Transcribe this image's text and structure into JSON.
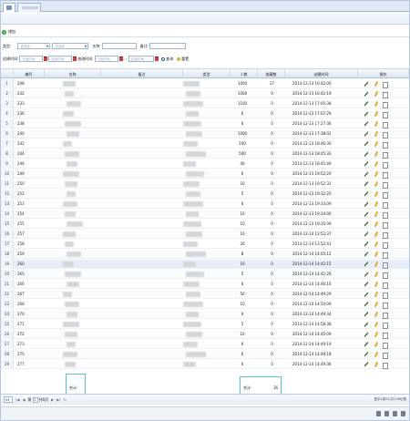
{
  "toolbar": {
    "add_label": "增加"
  },
  "filters": {
    "type_label": "类型:",
    "type_placeholder": "请选择",
    "name_label": "名称:",
    "remark_label": "备注:",
    "created_label": "创建时间:",
    "created_start_placeholder": "开始时间",
    "created_end_placeholder": "结束时间",
    "updated_label": "修改时间:",
    "updated_start_placeholder": "开始时间",
    "updated_end_placeholder": "结束时间",
    "search_label": "查询",
    "reset_label": "重置"
  },
  "grid": {
    "columns": [
      "编号",
      "名称",
      "备注",
      "类型",
      "人数",
      "收藏数",
      "创建时间",
      "操作"
    ],
    "rows": [
      {
        "index": "1",
        "code": "208",
        "people": "1000",
        "collects": "27",
        "time": "2014-12-13 16:42:00"
      },
      {
        "index": "2",
        "code": "232",
        "people": "1000",
        "collects": "0",
        "time": "2014-12-13 16:42:19"
      },
      {
        "index": "3",
        "code": "233",
        "people": "1100",
        "collects": "0",
        "time": "2014-12-13 17:05:38"
      },
      {
        "index": "4",
        "code": "236",
        "people": "6",
        "collects": "0",
        "time": "2014-12-13 17:07:29"
      },
      {
        "index": "5",
        "code": "238",
        "people": "6",
        "collects": "0",
        "time": "2014-12-13 17:27:36"
      },
      {
        "index": "6",
        "code": "240",
        "people": "1000",
        "collects": "0",
        "time": "2014-12-13 17:38:02"
      },
      {
        "index": "7",
        "code": "242",
        "people": "100",
        "collects": "0",
        "time": "2014-12-13 18:46:30"
      },
      {
        "index": "8",
        "code": "244",
        "people": "500",
        "collects": "0",
        "time": "2014-12-13 18:45:32"
      },
      {
        "index": "9",
        "code": "246",
        "people": "40",
        "collects": "0",
        "time": "2014-12-13 18:45:49"
      },
      {
        "index": "10",
        "code": "249",
        "people": "6",
        "collects": "0",
        "time": "2014-12-13 19:52:20"
      },
      {
        "index": "11",
        "code": "250",
        "people": "10",
        "collects": "0",
        "time": "2014-12-13 19:52:32"
      },
      {
        "index": "12",
        "code": "252",
        "people": "5",
        "collects": "0",
        "time": "2014-12-13 19:32:20"
      },
      {
        "index": "13",
        "code": "253",
        "people": "6",
        "collects": "0",
        "time": "2014-12-13 19:33:09"
      },
      {
        "index": "14",
        "code": "254",
        "people": "10",
        "collects": "0",
        "time": "2014-12-13 19:34:00"
      },
      {
        "index": "15",
        "code": "255",
        "people": "10",
        "collects": "0",
        "time": "2014-12-13 19:35:09"
      },
      {
        "index": "16",
        "code": "257",
        "people": "10",
        "collects": "0",
        "time": "2014-12-14 13:52:37"
      },
      {
        "index": "17",
        "code": "258",
        "people": "20",
        "collects": "0",
        "time": "2014-12-14 13:52:43"
      },
      {
        "index": "18",
        "code": "259",
        "people": "8",
        "collects": "0",
        "time": "2014-12-14 14:05:12"
      },
      {
        "index": "19",
        "code": "260",
        "people": "10",
        "collects": "0",
        "time": "2014-12-14 14:42:15"
      },
      {
        "index": "20",
        "code": "265",
        "people": "5",
        "collects": "0",
        "time": "2014-12-14 14:42:26"
      },
      {
        "index": "21",
        "code": "266",
        "people": "6",
        "collects": "0",
        "time": "2014-12-14 14:46:16"
      },
      {
        "index": "22",
        "code": "267",
        "people": "50",
        "collects": "0",
        "time": "2014-12-14 14:49:29"
      },
      {
        "index": "23",
        "code": "268",
        "people": "10",
        "collects": "0",
        "time": "2014-12-14 14:50:09"
      },
      {
        "index": "24",
        "code": "270",
        "people": "6",
        "collects": "0",
        "time": "2014-12-14 14:49:34"
      },
      {
        "index": "25",
        "code": "271",
        "people": "5",
        "collects": "0",
        "time": "2014-12-14 14:58:38"
      },
      {
        "index": "26",
        "code": "272",
        "people": "10",
        "collects": "0",
        "time": "2014-12-14 14:45:09"
      },
      {
        "index": "27",
        "code": "273",
        "people": "6",
        "collects": "0",
        "time": "2014-12-14 14:49:19"
      },
      {
        "index": "28",
        "code": "275",
        "people": "6",
        "collects": "0",
        "time": "2014-12-14 14:49:18"
      },
      {
        "index": "29",
        "code": "277",
        "people": "6",
        "collects": "0",
        "time": "2014-12-14 14:49:38"
      }
    ]
  },
  "summary": {
    "left_label": "合计:",
    "right_label": "合计:",
    "right_value": "36"
  },
  "pager": {
    "page_size": "25",
    "page_prefix": "第",
    "page_value": "1",
    "page_suffix": "共6页",
    "info": "显示1到25,共139记录"
  }
}
